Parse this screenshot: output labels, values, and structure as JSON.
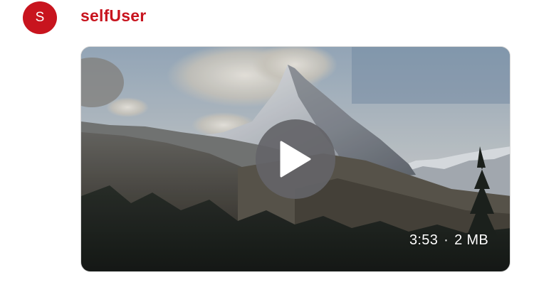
{
  "message": {
    "avatar_initial": "S",
    "sender_name": "selfUser",
    "colors": {
      "accent": "#c8141e",
      "avatar_text": "#ffffff"
    }
  },
  "video": {
    "duration": "3:53",
    "separator": "·",
    "size": "2 MB",
    "play_icon": "play-icon",
    "thumbnail_subject": "mountain-peak-thumbnail"
  }
}
